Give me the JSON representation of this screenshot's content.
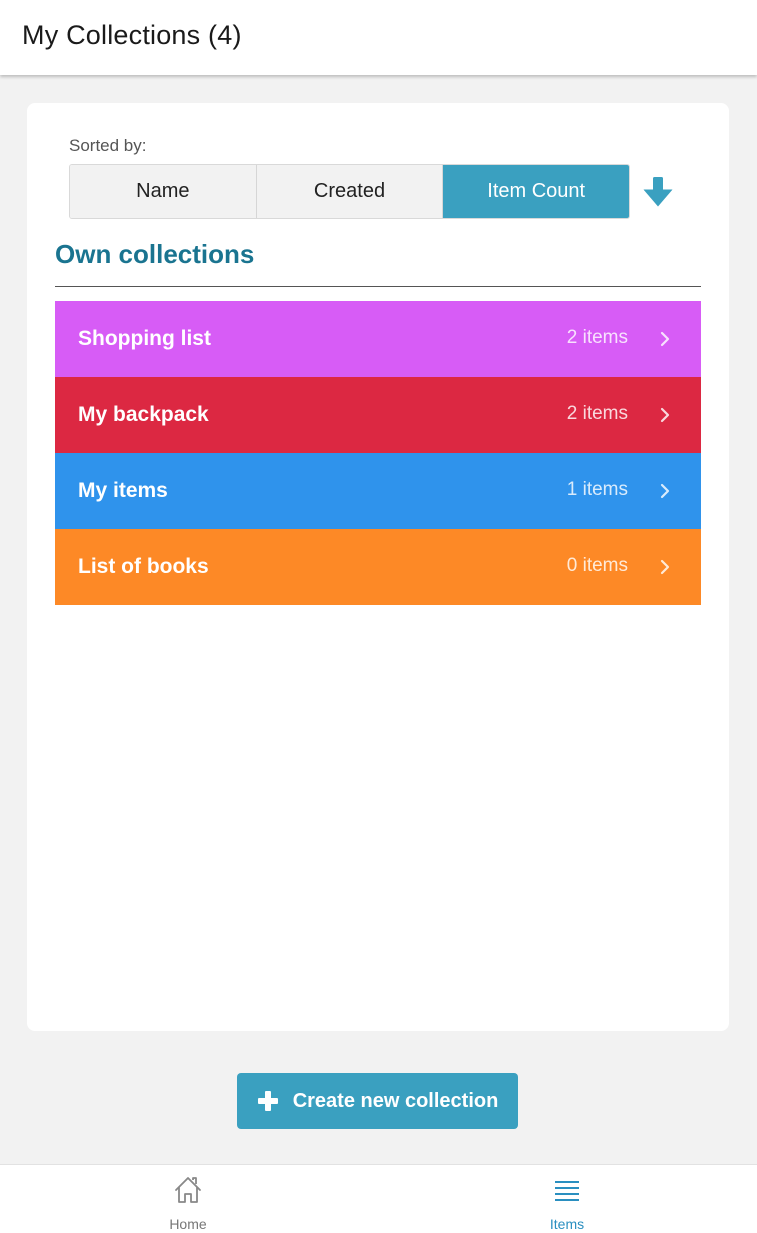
{
  "header": {
    "title": "My Collections (4)"
  },
  "sort": {
    "label": "Sorted by:",
    "options": [
      "Name",
      "Created",
      "Item Count"
    ],
    "active": "Item Count",
    "direction_icon": "arrow-down-icon"
  },
  "section": {
    "title": "Own collections"
  },
  "collections": [
    {
      "name": "Shopping list",
      "count": "2 items",
      "color": "#d75cf6"
    },
    {
      "name": "My backpack",
      "count": "2 items",
      "color": "#dc2842"
    },
    {
      "name": "My items",
      "count": "1 items",
      "color": "#2f93ec"
    },
    {
      "name": "List of books",
      "count": "0 items",
      "color": "#fd8926"
    }
  ],
  "create_button": {
    "label": "Create new collection",
    "icon": "plus-icon"
  },
  "bottom_nav": [
    {
      "label": "Home",
      "icon": "home-icon",
      "active": false
    },
    {
      "label": "Items",
      "icon": "list-icon",
      "active": true
    }
  ],
  "colors": {
    "accent": "#3aa0c0",
    "section_title": "#1a7490",
    "active_nav": "#2a8fc0"
  }
}
